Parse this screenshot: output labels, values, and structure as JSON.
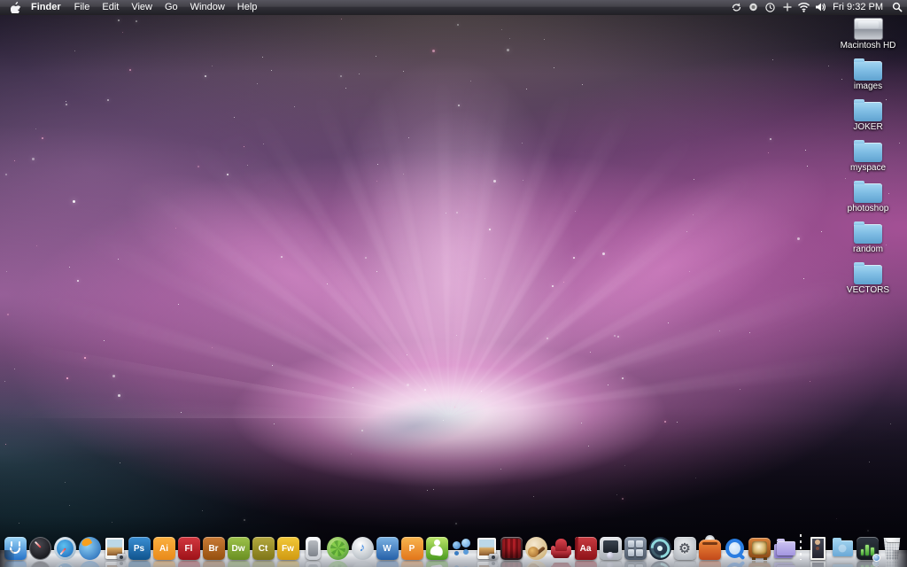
{
  "menu_bar": {
    "app_name": "Finder",
    "items": [
      "File",
      "Edit",
      "View",
      "Go",
      "Window",
      "Help"
    ],
    "status_icons": [
      "sync-icon",
      "displays-icon",
      "clock-icon",
      "input-icon",
      "wifi-icon",
      "volume-icon"
    ],
    "clock": "Fri 9:32 PM"
  },
  "desktop": {
    "icons": [
      {
        "label": "Macintosh HD",
        "type": "drive"
      },
      {
        "label": "images",
        "type": "folder"
      },
      {
        "label": "JOKER",
        "type": "folder"
      },
      {
        "label": "myspace",
        "type": "folder"
      },
      {
        "label": "photoshop",
        "type": "folder"
      },
      {
        "label": "random",
        "type": "folder"
      },
      {
        "label": "VECTORS",
        "type": "folder"
      }
    ]
  },
  "dock": {
    "items": [
      {
        "name": "finder",
        "kind": "finder"
      },
      {
        "name": "dashboard",
        "kind": "dashboard"
      },
      {
        "name": "safari",
        "kind": "safari"
      },
      {
        "name": "firefox",
        "kind": "firefox"
      },
      {
        "name": "preview",
        "kind": "photo-app"
      },
      {
        "name": "photoshop",
        "kind": "tile",
        "text": "Ps",
        "bg1": "#3a8fd4",
        "bg2": "#10548e"
      },
      {
        "name": "illustrator",
        "kind": "tile",
        "text": "Ai",
        "bg1": "#fbb03f",
        "bg2": "#e88a1a"
      },
      {
        "name": "flash",
        "kind": "tile",
        "text": "Fl",
        "bg1": "#d2373f",
        "bg2": "#9e1218"
      },
      {
        "name": "bridge",
        "kind": "tile",
        "text": "Br",
        "bg1": "#c97a35",
        "bg2": "#95500f"
      },
      {
        "name": "dreamweaver",
        "kind": "tile",
        "text": "Dw",
        "bg1": "#9dc24a",
        "bg2": "#6a8f22"
      },
      {
        "name": "contribute",
        "kind": "tile",
        "text": "Ct",
        "bg1": "#b4a83e",
        "bg2": "#7f7618"
      },
      {
        "name": "fireworks",
        "kind": "tile",
        "text": "Fw",
        "bg1": "#f2c838",
        "bg2": "#d09a12"
      },
      {
        "name": "remote",
        "kind": "remote"
      },
      {
        "name": "limewire",
        "kind": "limewire"
      },
      {
        "name": "itunes",
        "kind": "itunes"
      },
      {
        "name": "word",
        "kind": "tile",
        "text": "W",
        "bg1": "#7db4e4",
        "bg2": "#2560a8"
      },
      {
        "name": "powerpoint",
        "kind": "tile",
        "text": "P",
        "bg1": "#f8b54e",
        "bg2": "#e2761b"
      },
      {
        "name": "messenger",
        "kind": "messenger"
      },
      {
        "name": "ichat",
        "kind": "ichat"
      },
      {
        "name": "iphoto",
        "kind": "photo-app"
      },
      {
        "name": "photo-booth",
        "kind": "photobooth"
      },
      {
        "name": "garageband",
        "kind": "garageband"
      },
      {
        "name": "front-row",
        "kind": "frontrow"
      },
      {
        "name": "dictionary",
        "kind": "dictionary"
      },
      {
        "name": "meter",
        "kind": "meter"
      },
      {
        "name": "spaces",
        "kind": "spaces"
      },
      {
        "name": "time-machine",
        "kind": "timemachine"
      },
      {
        "name": "system-preferences",
        "kind": "sysprefs"
      },
      {
        "name": "toast",
        "kind": "toast"
      },
      {
        "name": "quicktime",
        "kind": "quicktime"
      },
      {
        "name": "tv",
        "kind": "tv"
      },
      {
        "name": "documents-stack",
        "kind": "folderstack"
      },
      {
        "name": "separator",
        "kind": "separator"
      },
      {
        "name": "poster-stack",
        "kind": "poster"
      },
      {
        "name": "downloads-folder",
        "kind": "downloads"
      },
      {
        "name": "dark-stack",
        "kind": "darkstack"
      },
      {
        "name": "trash",
        "kind": "trash"
      }
    ]
  }
}
